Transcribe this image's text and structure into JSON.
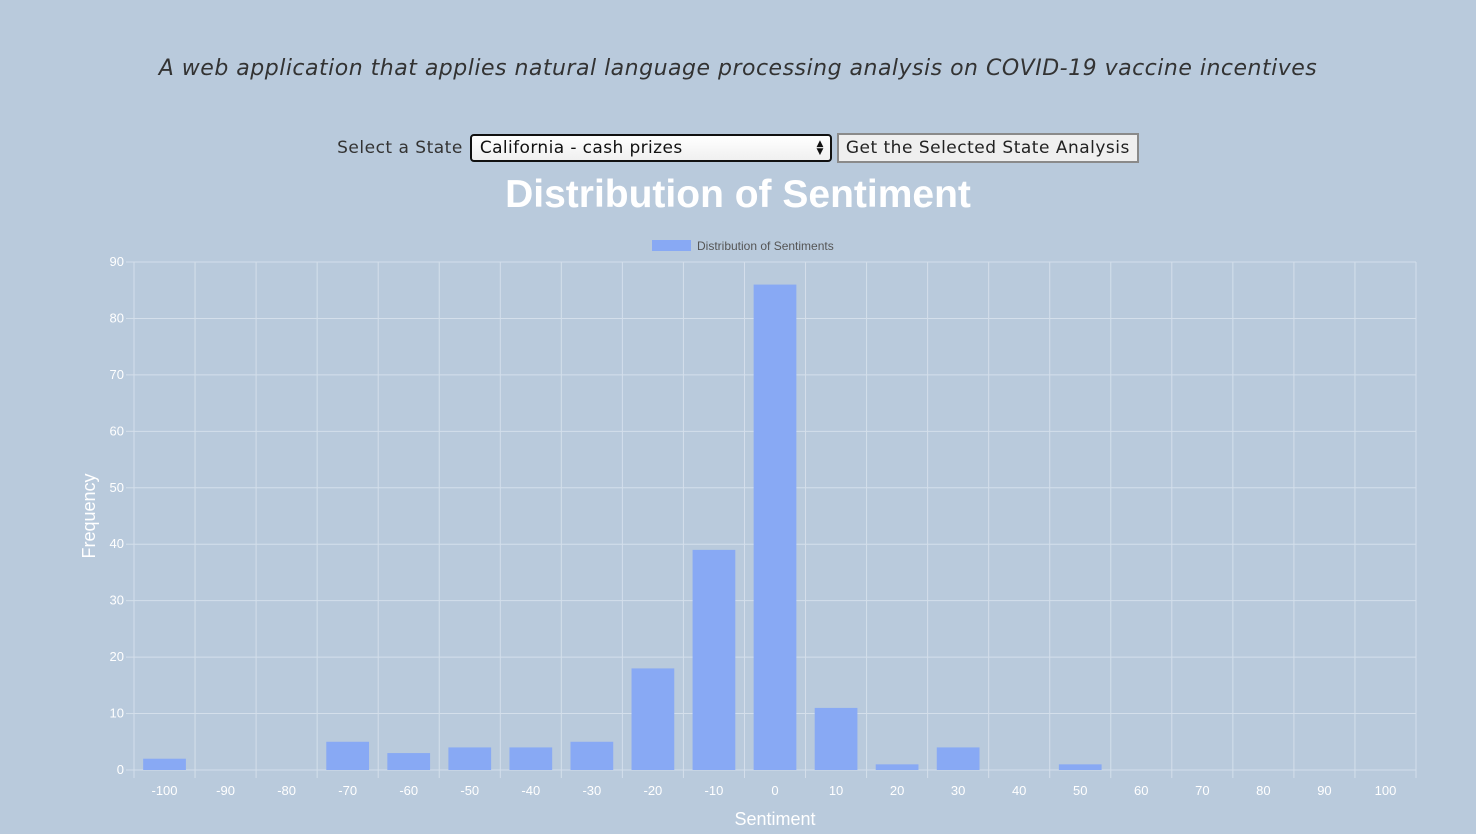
{
  "header": {
    "subtitle": "A web application that applies natural language processing analysis on COVID-19 vaccine incentives"
  },
  "controls": {
    "select_label": "Select a State",
    "select_value": "California - cash prizes",
    "button_label": "Get the Selected State Analysis"
  },
  "chart_data": {
    "type": "bar",
    "title": "Distribution of Sentiment",
    "xlabel": "Sentiment",
    "ylabel": "Frequency",
    "legend": {
      "label": "Distribution of Sentiments",
      "placement": "top-center"
    },
    "categories": [
      "-100",
      "-90",
      "-80",
      "-70",
      "-60",
      "-50",
      "-40",
      "-30",
      "-20",
      "-10",
      "0",
      "10",
      "20",
      "30",
      "40",
      "50",
      "60",
      "70",
      "80",
      "90",
      "100"
    ],
    "values": [
      2,
      0,
      0,
      5,
      3,
      4,
      4,
      5,
      18,
      39,
      86,
      11,
      1,
      4,
      0,
      1,
      0,
      0,
      0,
      0,
      0
    ],
    "ylim": [
      0,
      90
    ],
    "yticks": [
      0,
      10,
      20,
      30,
      40,
      50,
      60,
      70,
      80,
      90
    ],
    "grid": true,
    "colors": {
      "bar": "#88a9f4",
      "text": "#ffffff",
      "grid": "#d4dfeb"
    }
  }
}
